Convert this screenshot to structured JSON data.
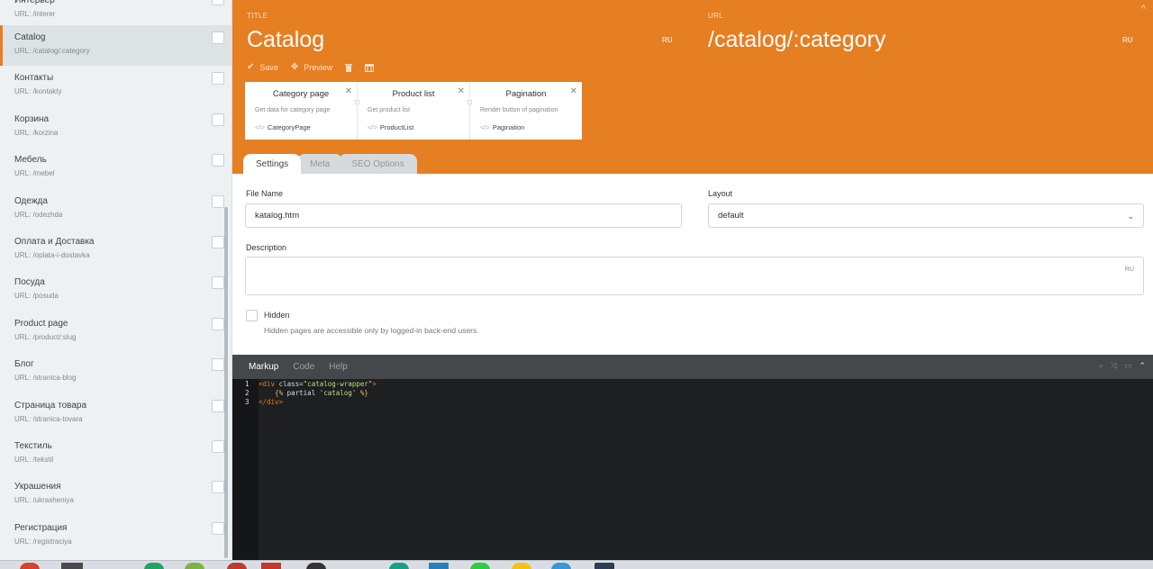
{
  "sidebar": {
    "items": [
      {
        "title": "Интерьер",
        "url": "URL: /interer"
      },
      {
        "title": "Catalog",
        "url": "URL: /catalog/:category"
      },
      {
        "title": "Контакты",
        "url": "URL: /kontakty"
      },
      {
        "title": "Корзина",
        "url": "URL: /korzina"
      },
      {
        "title": "Мебель",
        "url": "URL: /mebel"
      },
      {
        "title": "Одежда",
        "url": "URL: /odezhda"
      },
      {
        "title": "Оплата и Доставка",
        "url": "URL: /oplata-i-dostavka"
      },
      {
        "title": "Посуда",
        "url": "URL: /posuda"
      },
      {
        "title": "Product page",
        "url": "URL: /product/:slug"
      },
      {
        "title": "Блог",
        "url": "URL: /stranica-blog"
      },
      {
        "title": "Страница товара",
        "url": "URL: /stranica-tovara"
      },
      {
        "title": "Текстиль",
        "url": "URL: /tekstil"
      },
      {
        "title": "Украшения",
        "url": "URL: /ukrasheniya"
      },
      {
        "title": "Регистрация",
        "url": "URL: /registraciya"
      }
    ]
  },
  "header": {
    "title_label": "TITLE",
    "title_value": "Catalog",
    "title_locale": "RU",
    "url_label": "URL",
    "url_value": "/catalog/:category",
    "url_locale": "RU",
    "close": "^",
    "toolbar": {
      "save": "Save",
      "preview": "Preview"
    }
  },
  "components": [
    {
      "title": "Category page",
      "desc": "Get data for category page",
      "alias": "CategoryPage"
    },
    {
      "title": "Product list",
      "desc": "Get product list",
      "alias": "ProductList"
    },
    {
      "title": "Pagination",
      "desc": "Render button of pagination",
      "alias": "Pagination"
    }
  ],
  "tabs": {
    "settings": "Settings",
    "meta": "Meta",
    "seo": "SEO Options"
  },
  "form": {
    "file_name_label": "File Name",
    "file_name_value": "katalog.htm",
    "layout_label": "Layout",
    "layout_value": "default",
    "description_label": "Description",
    "description_locale": "RU",
    "hidden_label": "Hidden",
    "hidden_help": "Hidden pages are accessible only by logged-in back-end users."
  },
  "editor": {
    "tabs": {
      "markup": "Markup",
      "code": "Code",
      "help": "Help"
    },
    "line_numbers": [
      "1",
      "2",
      "3"
    ],
    "line1": {
      "open": "<div ",
      "attr": "class=",
      "value": "\"catalog-wrapper\"",
      "close": ">"
    },
    "line2": {
      "open": "    {% ",
      "kw": "partial ",
      "value": "'catalog'",
      "close": " %}"
    },
    "line3": {
      "tag": "</div>"
    }
  },
  "colors": {
    "accent": "#e67e22",
    "editor_bg": "#1d1f21",
    "sidebar_bg": "#eef1f3"
  }
}
